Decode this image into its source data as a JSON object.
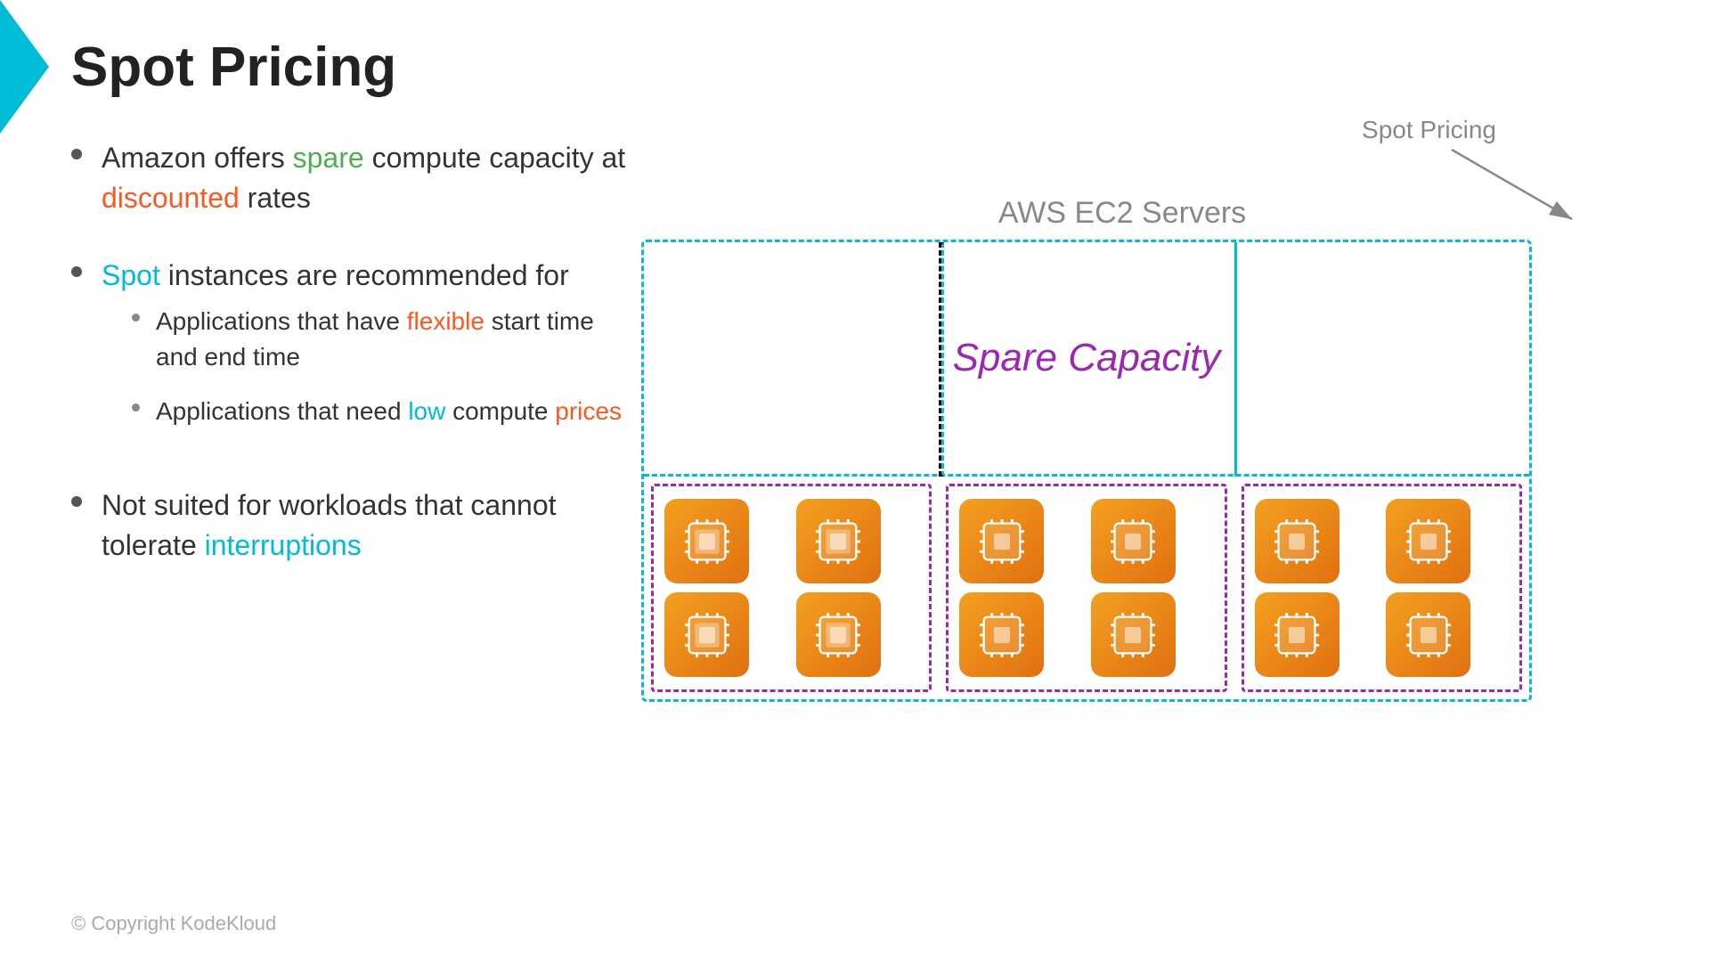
{
  "title": "Spot Pricing",
  "bullets": [
    {
      "id": "b1",
      "parts": [
        {
          "text": "Amazon offers ",
          "color": "normal"
        },
        {
          "text": "spare",
          "color": "green"
        },
        {
          "text": " compute capacity at ",
          "color": "normal"
        },
        {
          "text": "discounted",
          "color": "orange"
        },
        {
          "text": " rates",
          "color": "normal"
        }
      ],
      "sub": []
    },
    {
      "id": "b2",
      "parts": [
        {
          "text": "Spot",
          "color": "teal"
        },
        {
          "text": " instances are recommended for",
          "color": "normal"
        }
      ],
      "sub": [
        {
          "parts": [
            {
              "text": "Applications that have ",
              "color": "normal"
            },
            {
              "text": "flexible",
              "color": "orange"
            },
            {
              "text": " start time and end time",
              "color": "normal"
            }
          ]
        },
        {
          "parts": [
            {
              "text": "Applications that need ",
              "color": "normal"
            },
            {
              "text": "low",
              "color": "teal"
            },
            {
              "text": " compute ",
              "color": "normal"
            },
            {
              "text": "prices",
              "color": "orange"
            }
          ]
        }
      ]
    },
    {
      "id": "b3",
      "parts": [
        {
          "text": "Not suited for workloads that cannot tolerate ",
          "color": "normal"
        },
        {
          "text": "interruptions",
          "color": "teal"
        }
      ],
      "sub": []
    }
  ],
  "diagram": {
    "ec2_label": "AWS EC2 Servers",
    "spot_pricing_label": "Spot Pricing",
    "spare_capacity_label": "Spare Capacity"
  },
  "copyright": "© Copyright KodeKloud",
  "colors": {
    "green": "#4caf50",
    "orange": "#ff5722",
    "teal": "#00bcd4",
    "purple": "#9c27b0",
    "accent": "#00bcd4"
  }
}
